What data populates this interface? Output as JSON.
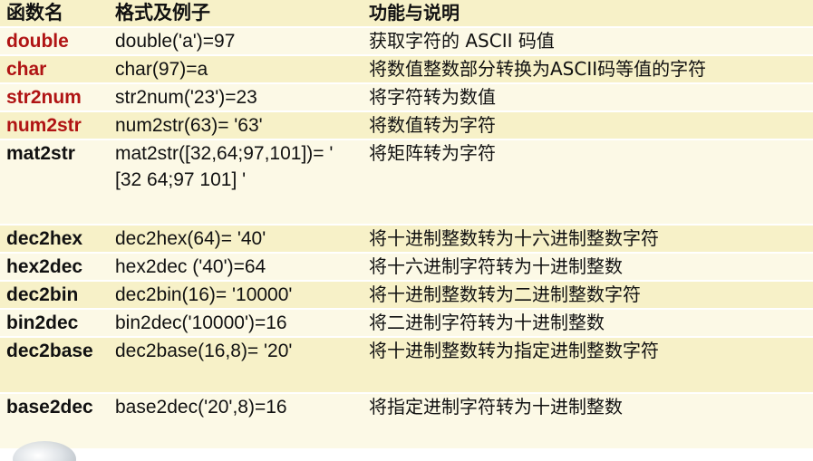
{
  "headers": {
    "name": "函数名",
    "format": "格式及例子",
    "desc": "功能与说明"
  },
  "rows": [
    {
      "name": "double",
      "format": "double('a')=97",
      "desc": "获取字符的 ASCII 码值",
      "highlight": true
    },
    {
      "name": "char",
      "format": "char(97)=a",
      "desc": "将数值整数部分转换为ASCII码等值的字符",
      "highlight": true
    },
    {
      "name": "str2num",
      "format": "str2num('23')=23",
      "desc": "将字符转为数值",
      "highlight": true
    },
    {
      "name": "num2str",
      "format": "num2str(63)= '63'",
      "desc": "将数值转为字符",
      "highlight": true
    },
    {
      "name": "mat2str",
      "format": "mat2str([32,64;97,101])= ' [32 64;97 101] '",
      "desc": "将矩阵转为字符",
      "highlight": false
    },
    {
      "name": "dec2hex",
      "format": "dec2hex(64)= '40'",
      "desc": "将十进制整数转为十六进制整数字符",
      "highlight": false
    },
    {
      "name": "hex2dec",
      "format": "hex2dec ('40')=64",
      "desc": "将十六进制字符转为十进制整数",
      "highlight": false
    },
    {
      "name": "dec2bin",
      "format": "dec2bin(16)= '10000'",
      "desc": "将十进制整数转为二进制整数字符",
      "highlight": false
    },
    {
      "name": "bin2dec",
      "format": "bin2dec('10000')=16",
      "desc": "将二进制字符转为十进制整数",
      "highlight": false
    },
    {
      "name": "dec2base",
      "format": "dec2base(16,8)= '20'",
      "desc": "将十进制整数转为指定进制整数字符",
      "highlight": false
    },
    {
      "name": "base2dec",
      "format": "base2dec('20',8)=16",
      "desc": "将指定进制字符转为十进制整数",
      "highlight": false
    }
  ],
  "colors": {
    "highlight_name": "#b01414",
    "row_dark": "#f7f1c8",
    "row_light": "#fcf9e6"
  }
}
